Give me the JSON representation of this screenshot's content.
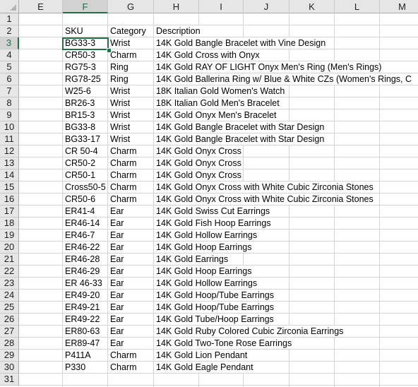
{
  "columns": [
    "E",
    "F",
    "G",
    "H",
    "I",
    "J",
    "K",
    "L",
    "M"
  ],
  "selected_column": "F",
  "selected_row": 3,
  "row_numbers": [
    1,
    2,
    3,
    4,
    5,
    6,
    7,
    8,
    9,
    10,
    11,
    12,
    13,
    14,
    15,
    16,
    17,
    18,
    19,
    20,
    21,
    22,
    23,
    24,
    25,
    26,
    27,
    28,
    29,
    30,
    31
  ],
  "headers": {
    "sku": "SKU",
    "category": "Category",
    "description": "Description"
  },
  "rows": [
    [
      "BG33-3",
      "Wrist",
      "14K Gold Bangle Bracelet with Vine Design"
    ],
    [
      "CR50-3",
      "Charm",
      "14K Gold Cross with Onyx"
    ],
    [
      "RG75-3",
      "Ring",
      "14K Gold RAY OF LIGHT Onyx Men's Ring (Men's Rings)"
    ],
    [
      "RG78-25",
      "Ring",
      "14K Gold Ballerina Ring w/ Blue & White CZs (Women's Rings, C"
    ],
    [
      "W25-6",
      "Wrist",
      "18K Italian Gold Women's Watch"
    ],
    [
      "BR26-3",
      "Wrist",
      "18K Italian Gold Men's Bracelet"
    ],
    [
      "BR15-3",
      "Wrist",
      "14K Gold Onyx Men's Bracelet"
    ],
    [
      "BG33-8",
      "Wrist",
      "14K Gold Bangle Bracelet with Star Design"
    ],
    [
      "BG33-17",
      "Wrist",
      "14K Gold Bangle Bracelet with Star Design"
    ],
    [
      "CR 50-4",
      "Charm",
      "14K Gold Onyx Cross"
    ],
    [
      "CR50-2",
      "Charm",
      "14K Gold Onyx Cross"
    ],
    [
      "CR50-1",
      "Charm",
      "14K Gold Onyx Cross"
    ],
    [
      "Cross50-5",
      "Charm",
      "14K Gold Onyx Cross with White Cubic Zirconia Stones"
    ],
    [
      "CR50-6",
      "Charm",
      "14K Gold Onyx Cross with White Cubic Zirconia Stones"
    ],
    [
      "ER41-4",
      "Ear",
      "14K Gold Swiss Cut Earrings"
    ],
    [
      "ER46-14",
      "Ear",
      "14K Gold Fish Hoop Earrings"
    ],
    [
      "ER46-7",
      "Ear",
      "14K Gold Hollow Earrings"
    ],
    [
      "ER46-22",
      "Ear",
      "14K Gold Hoop Earrings"
    ],
    [
      "ER46-28",
      "Ear",
      "14K Gold Earrings"
    ],
    [
      "ER46-29",
      "Ear",
      "14K Gold Hoop Earrings"
    ],
    [
      "ER 46-33",
      "Ear",
      "14K Gold Hollow Earrings"
    ],
    [
      "ER49-20",
      "Ear",
      "14K Gold Hoop/Tube Earrings"
    ],
    [
      "ER49-21",
      "Ear",
      "14K Gold Hoop/Tube Earrings"
    ],
    [
      "ER49-22",
      "Ear",
      "14K Gold Tube/Hoop Earrings"
    ],
    [
      "ER80-63",
      "Ear",
      "14K Gold Ruby Colored Cubic Zirconia Earrings"
    ],
    [
      "ER89-47",
      "Ear",
      "14K Gold Two-Tone Rose Earrings"
    ],
    [
      "P411A",
      "Charm",
      "14K Gold Lion Pendant"
    ],
    [
      "P330",
      "Charm",
      "14K Gold Eagle Pendant"
    ]
  ],
  "colors": {
    "accent": "#217346",
    "header_bg": "#e6e6e6",
    "gridline": "#d4d4d4"
  }
}
